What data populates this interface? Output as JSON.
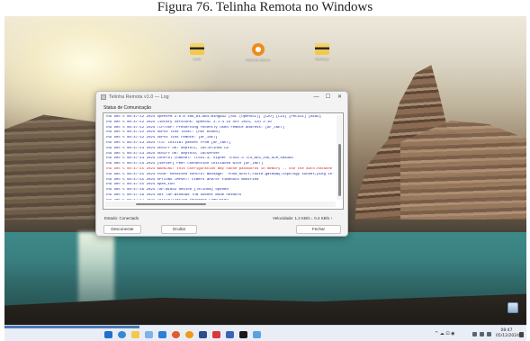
{
  "caption": "Figura 76. Telinha Remota no Windows",
  "desktop": {
    "icons": [
      {
        "label": "tools"
      },
      {
        "label": "Remote Server"
      },
      {
        "label": "Desktop"
      }
    ]
  },
  "dialog": {
    "title": "Telinha Remota v1.0 — Log",
    "section_label": "Status de Comunicação",
    "log_lines": [
      {
        "text": "Thu Dec  5 08:47:12 2024 OpenVPN 2.6.8 x86_64-w64-mingw32 [SSL (OpenSSL)] [LZO] [LZ4] [PKCS11] [AEAD]",
        "error": false
      },
      {
        "text": "Thu Dec  5 08:47:12 2024 library versions: OpenSSL 3.1.4 24 Oct 2023, LZO 2.10",
        "error": false
      },
      {
        "text": "Thu Dec  5 08:47:12 2024 TCP/UDP: Preserving recently used remote address: [AF_INET]",
        "error": false
      },
      {
        "text": "Thu Dec  5 08:47:12 2024 UDPv4 link local: (not bound)",
        "error": false
      },
      {
        "text": "Thu Dec  5 08:47:12 2024 UDPv4 link remote: [AF_INET]",
        "error": false
      },
      {
        "text": "Thu Dec  5 08:47:13 2024 TLS: Initial packet from [AF_INET]",
        "error": false
      },
      {
        "text": "Thu Dec  5 08:47:13 2024 VERIFY OK: depth=1, CN=Telinha CA",
        "error": false
      },
      {
        "text": "Thu Dec  5 08:47:13 2024 VERIFY OK: depth=0, CN=server",
        "error": false
      },
      {
        "text": "Thu Dec  5 08:47:14 2024 Control Channel: TLSv1.3, cipher TLSv1.3 TLS_AES_256_GCM_SHA384",
        "error": false
      },
      {
        "text": "Thu Dec  5 08:47:14 2024 [server] Peer Connection Initiated with [AF_INET]",
        "error": false
      },
      {
        "text": "Thu Dec  5 08:47:15 2024 WARNING: this configuration may cache passwords in memory -- use the auth-nocache option",
        "error": true
      },
      {
        "text": "Thu Dec  5 08:47:15 2024 PUSH: Received control message: 'PUSH_REPLY,route-gateway,topology subnet,ping 10'",
        "error": false
      },
      {
        "text": "Thu Dec  5 08:47:15 2024 OPTIONS IMPORT: timers and/or timeouts modified",
        "error": false
      },
      {
        "text": "Thu Dec  5 08:47:15 2024 open_tun",
        "error": false
      },
      {
        "text": "Thu Dec  5 08:47:16 2024 TAP-WIN32 device [Telinha] opened",
        "error": false
      },
      {
        "text": "Thu Dec  5 08:47:16 2024 Set TAP-Windows TUN subnet mode network",
        "error": false
      },
      {
        "text": "Thu Dec  5 08:47:17 2024 Initialization Sequence Completed",
        "error": false
      }
    ],
    "status_left": "Estado: Conectado",
    "status_right": "Velocidade: 1.2 KB/s ↓ 0.4 KB/s ↑",
    "buttons": {
      "disconnect": "Desconectar",
      "hide": "Ocultar",
      "close": "Fechar"
    },
    "window_buttons": {
      "minimize": "—",
      "maximize": "☐",
      "close": "✕"
    }
  },
  "taskbar": {
    "tray_text": "^ ☁ ⊡ ◉",
    "clock_time": "08:47",
    "clock_date": "05/12/2024"
  },
  "colors": {
    "log_text": "#1a2a9a",
    "log_error": "#d02020",
    "taskbar_bg": "#e9eef6",
    "dialog_bg": "#f3f3f3"
  }
}
